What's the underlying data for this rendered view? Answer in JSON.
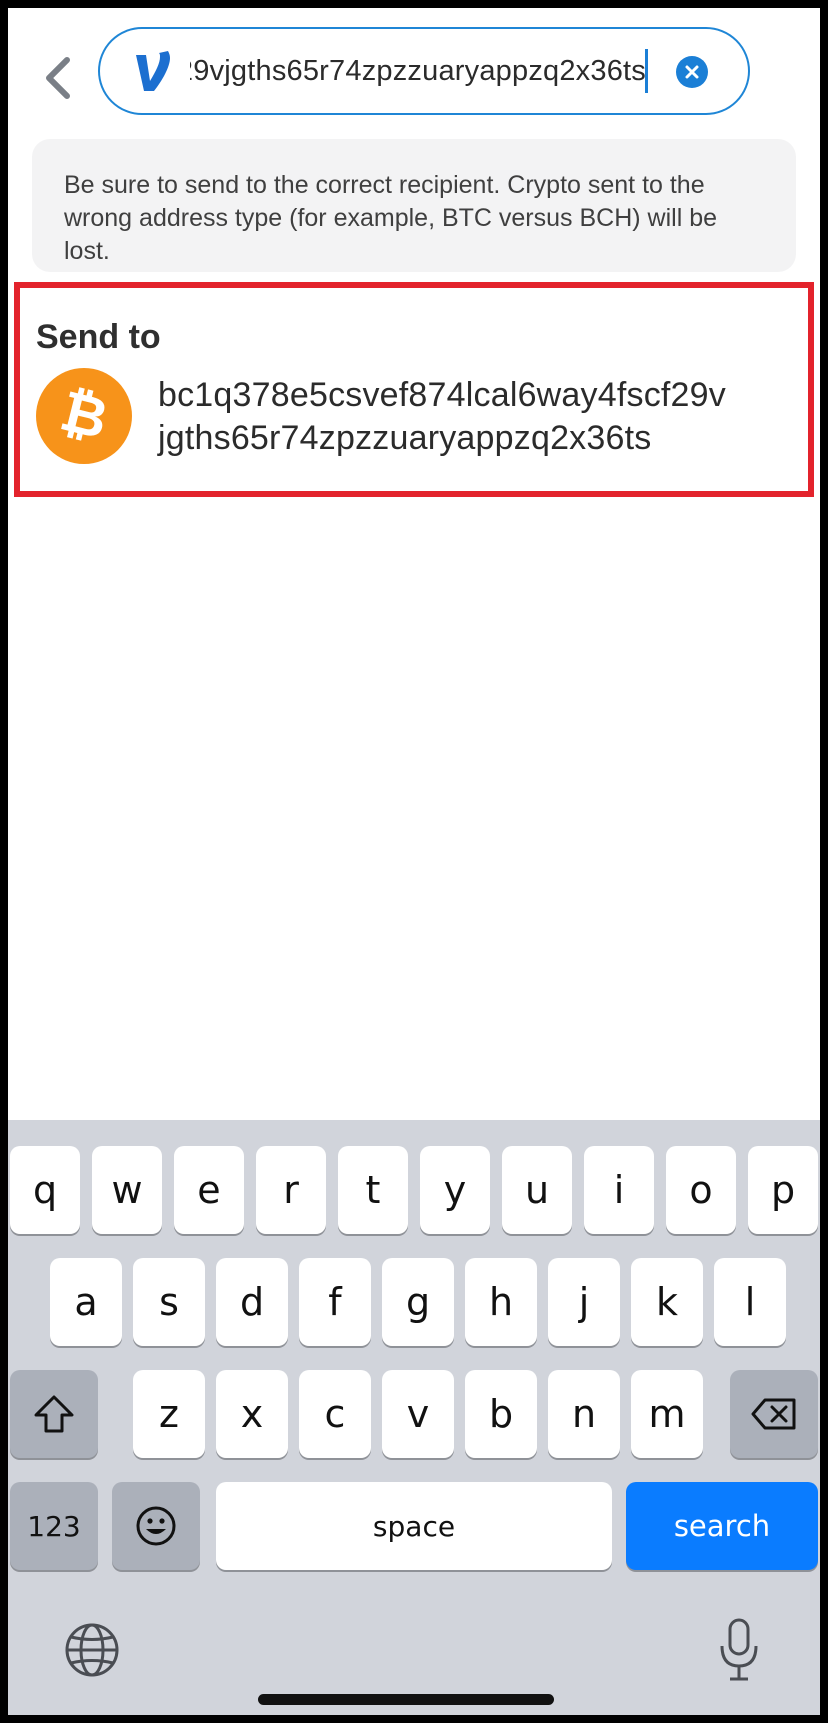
{
  "header": {
    "search_value": "bc1q378e5csvef874lcal6way4fscf29vjgths65r74zpzzuaryappzq2x36ts",
    "logo_glyph": "V"
  },
  "warning": {
    "text": "Be sure to send to the correct recipient. Crypto sent to the wrong address type (for example, BTC versus BCH) will be lost."
  },
  "send_to": {
    "title": "Send to",
    "address_line1": "bc1q378e5csvef874lcal6way4fscf29v",
    "address_line2": "jgths65r74zpzzuaryappzq2x36ts",
    "icon_glyph": "₿"
  },
  "keyboard": {
    "row1": [
      "q",
      "w",
      "e",
      "r",
      "t",
      "y",
      "u",
      "i",
      "o",
      "p"
    ],
    "row2": [
      "a",
      "s",
      "d",
      "f",
      "g",
      "h",
      "j",
      "k",
      "l"
    ],
    "row3": [
      "z",
      "x",
      "c",
      "v",
      "b",
      "n",
      "m"
    ],
    "numbers_label": "123",
    "space_label": "space",
    "search_label": "search"
  },
  "colors": {
    "accent": "#1b7fd6",
    "highlight": "#e3232c",
    "bitcoin": "#f7931a",
    "search_key": "#0a7cff"
  }
}
